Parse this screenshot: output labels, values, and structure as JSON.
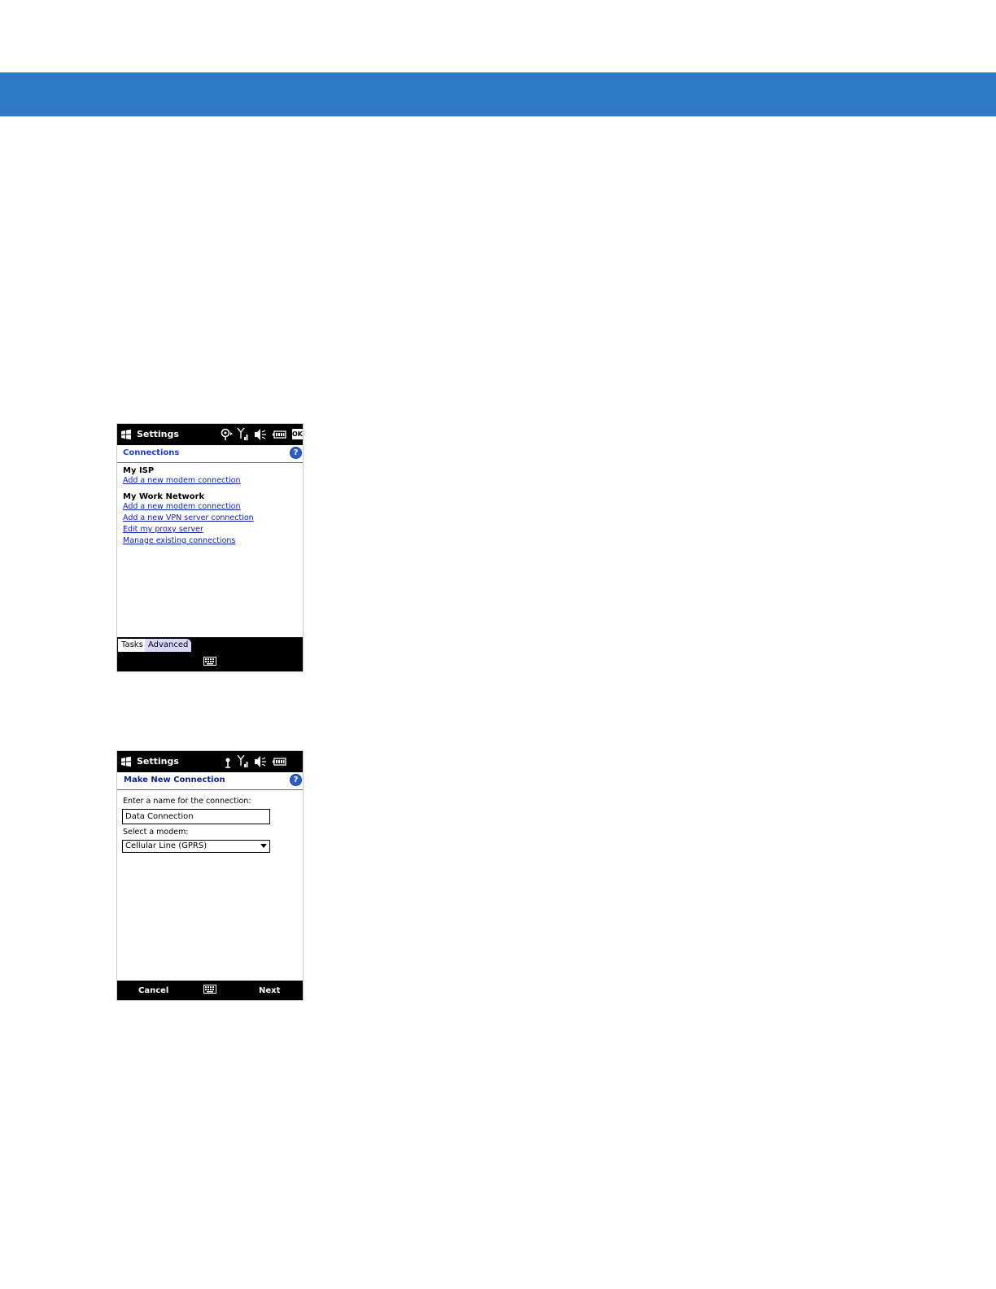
{
  "screen1": {
    "title": "Settings",
    "ok_label": "OK",
    "header": "Connections",
    "help": "?",
    "sections": [
      {
        "title": "My ISP",
        "links": [
          "Add a new modem connection"
        ]
      },
      {
        "title": "My Work Network",
        "links": [
          "Add a new modem connection",
          "Add a new VPN server connection",
          "Edit my proxy server",
          "Manage existing connections"
        ]
      }
    ],
    "tabs": [
      "Tasks",
      "Advanced"
    ]
  },
  "screen2": {
    "title": "Settings",
    "header": "Make New Connection",
    "help": "?",
    "name_label": "Enter a name for the connection:",
    "name_value": "Data Connection",
    "modem_label": "Select a modem:",
    "modem_value": "Cellular Line (GPRS)",
    "softkey_left": "Cancel",
    "softkey_right": "Next"
  },
  "colors": {
    "band": "#2f7bc9",
    "link": "#0c1fa8",
    "header": "#1f3fbf",
    "tab_advanced": "#d9d6ff"
  }
}
